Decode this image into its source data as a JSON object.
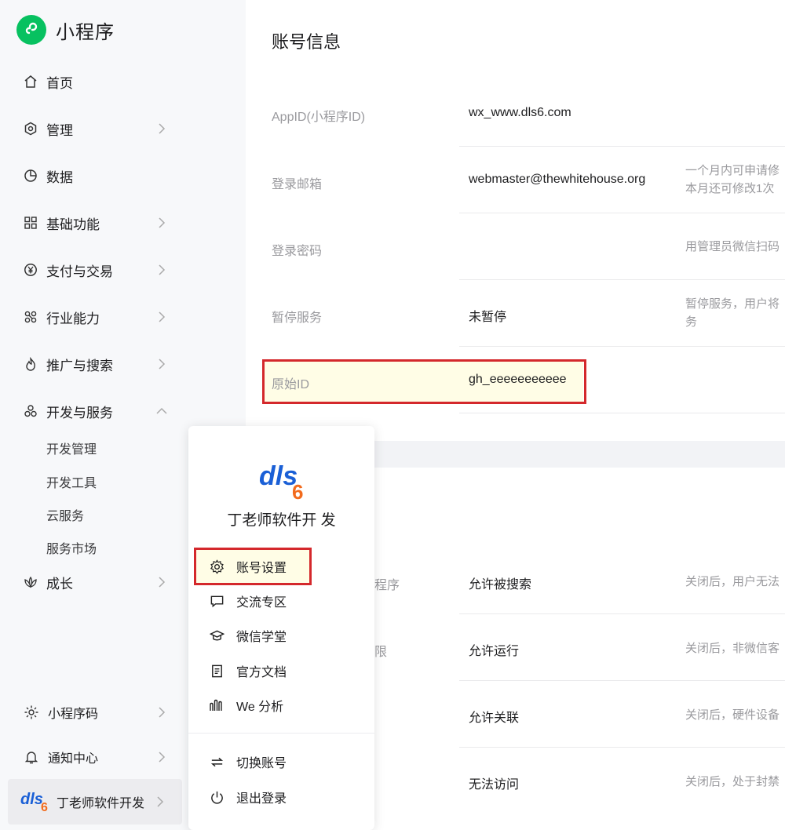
{
  "sidebar": {
    "brand_title": "小程序",
    "nav": [
      {
        "label": "首页",
        "icon": "home-icon"
      },
      {
        "label": "管理",
        "icon": "hexagon-settings-icon"
      },
      {
        "label": "数据",
        "icon": "pie-chart-icon"
      },
      {
        "label": "基础功能",
        "icon": "grid-apps-icon"
      },
      {
        "label": "支付与交易",
        "icon": "yen-coin-icon"
      },
      {
        "label": "行业能力",
        "icon": "molecule-icon"
      },
      {
        "label": "推广与搜索",
        "icon": "flame-icon"
      },
      {
        "label": "开发与服务",
        "icon": "cluster-icon"
      },
      {
        "label": "成长",
        "icon": "lotus-icon"
      }
    ],
    "dev_sub": [
      "开发管理",
      "开发工具",
      "云服务",
      "服务市场"
    ],
    "bottom": [
      {
        "label": "小程序码",
        "icon": "sun-code-icon"
      },
      {
        "label": "通知中心",
        "icon": "bell-icon"
      }
    ],
    "account_name": "丁老师软件开发"
  },
  "account_info": {
    "title": "账号信息",
    "rows": [
      {
        "label": "AppID(小程序ID)",
        "value": "wx_www.dls6.com",
        "note": ""
      },
      {
        "label": "登录邮箱",
        "value": "webmaster@thewhitehouse.org",
        "note": "一个月内可申请修",
        "note2": "本月还可修改1次"
      },
      {
        "label": "登录密码",
        "value": "",
        "note": "用管理员微信扫码"
      },
      {
        "label": "暂停服务",
        "value": "未暂停",
        "note": "暂停服务，用户将",
        "note2": "务"
      },
      {
        "label": "原始ID",
        "value": "gh_eeeeeeeeeee",
        "note": ""
      }
    ]
  },
  "settings": {
    "rows": [
      {
        "label_tail": "程序",
        "value": "允许被搜索",
        "note": "关闭后，用户无法"
      },
      {
        "label_tail": "限",
        "value": "允许运行",
        "note": "关闭后，非微信客"
      },
      {
        "label_tail": "",
        "value": "允许关联",
        "note": "关闭后，硬件设备"
      },
      {
        "label_tail": "",
        "value": "无法访问",
        "note": "关闭后，处于封禁"
      }
    ]
  },
  "popup": {
    "logo_text": "dls",
    "logo_sub": "6",
    "org_name": "丁老师软件开 发",
    "menu": [
      {
        "label": "账号设置",
        "icon": "gear-icon"
      },
      {
        "label": "交流专区",
        "icon": "chat-bubble-icon"
      },
      {
        "label": "微信学堂",
        "icon": "graduation-cap-icon"
      },
      {
        "label": "官方文档",
        "icon": "document-icon"
      },
      {
        "label": "We 分析",
        "icon": "analytics-icon"
      }
    ],
    "menu2": [
      {
        "label": "切换账号",
        "icon": "switch-arrows-icon"
      },
      {
        "label": "退出登录",
        "icon": "power-icon"
      }
    ]
  },
  "colors": {
    "brand_green": "#07c160",
    "highlight_red": "#d4282c",
    "highlight_fill": "#fffde6",
    "logo_blue": "#1a5fd6",
    "logo_orange": "#f26b1d"
  }
}
